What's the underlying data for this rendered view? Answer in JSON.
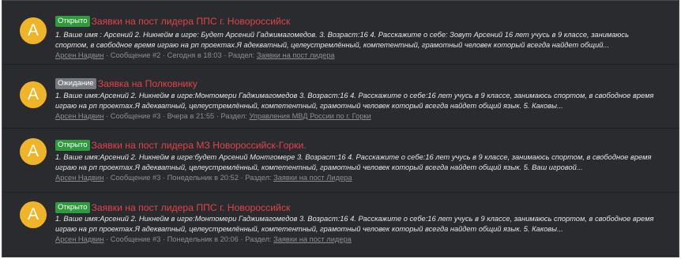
{
  "threads": [
    {
      "avatar_letter": "A",
      "badge": "Открыто",
      "title": "Заявки на пост лидера ППС г. Новороссийск",
      "snippet": "1. Ваше имя : Арсений 2. Никнейм в игре: Будет Арсений Гаджимагомедов. 3. Возраст:16 4. Расскажите о себе: Зовут Арсений 16 лет учусь в 9 классе, занимаюсь спортом, в свободное время играю на рп проектах.Я адекватный, целеустремлённый, компетентный, грамотный человек который всегда найдет общий...",
      "author": "Арсен Надвин",
      "message": "Сообщение #2",
      "date": "Сегодня в 18:03",
      "section_label": "Раздел:",
      "section": "Заявки на пост лидера"
    },
    {
      "avatar_letter": "A",
      "badge": "Ожидание",
      "title": "Заявка на Полковнику",
      "snippet": "1. Ваше имя:Арсений 2. Никнейм в игре:Монтомери Гаджимагомедов 3. Возраст:16 4. Расскажите о себе:16 лет учусь в 9 классе, занимаюсь спортом, в свободное время играю на рп проектах.Я адекватный, целеустремлённый, компетентный, грамотный человек который всегда найдет общий язык. 5. Каковы...",
      "author": "Арсен Надвин",
      "message": "Сообщение #3",
      "date": "Вчера в 21:55",
      "section_label": "Раздел:",
      "section": "Управления МВД России по г. Горки"
    },
    {
      "avatar_letter": "A",
      "badge": "Открыто",
      "title": "Заявки на пост лидера МЗ Новороссийск-Горки.",
      "snippet": "1. Ваше имя:Арсений 2. Никнейм в игре:будет Арсений Монтгомере 3. Возраст:16 4. Расскажите о себе:16 лет учусь в 9 классе, занимаюсь спортом, в свободное время играю на рп проектах.Я адекватный, целеустремлённый, компетентный, грамотный человек который всегда найдет общий язык. 5. Ваш игровой...",
      "author": "Арсен Надвин",
      "message": "Сообщение #3",
      "date": "Понедельник в 20:52",
      "section_label": "Раздел:",
      "section": "Заявки на пост Лидера"
    },
    {
      "avatar_letter": "A",
      "badge": "Открыто",
      "title": "Заявки на пост лидера ППС г. Новороссийск",
      "snippet": "1. Ваше имя:Арсений 2. Никнейм в игре:Монтомери Гаджимагомедов 3. Возраст:16 4. Расскажите о себе:16 лет учусь в 9 классе, занимаюсь спортом, в свободное время играю на рп проектах.Я адекватный, целеустремлённый, компетентный, грамотный человек который всегда найдет общий язык. 5. Каковы...",
      "author": "Арсен Надвин",
      "message": "Сообщение #3",
      "date": "Понедельник в 20:06",
      "section_label": "Раздел:",
      "section": "Заявки на пост лидера"
    }
  ],
  "colors": {
    "background": "#2a2b2e",
    "title": "#e0434b",
    "badge_open": "#2f9a3e",
    "badge_wait": "#777a80",
    "avatar": "#f0b429"
  }
}
